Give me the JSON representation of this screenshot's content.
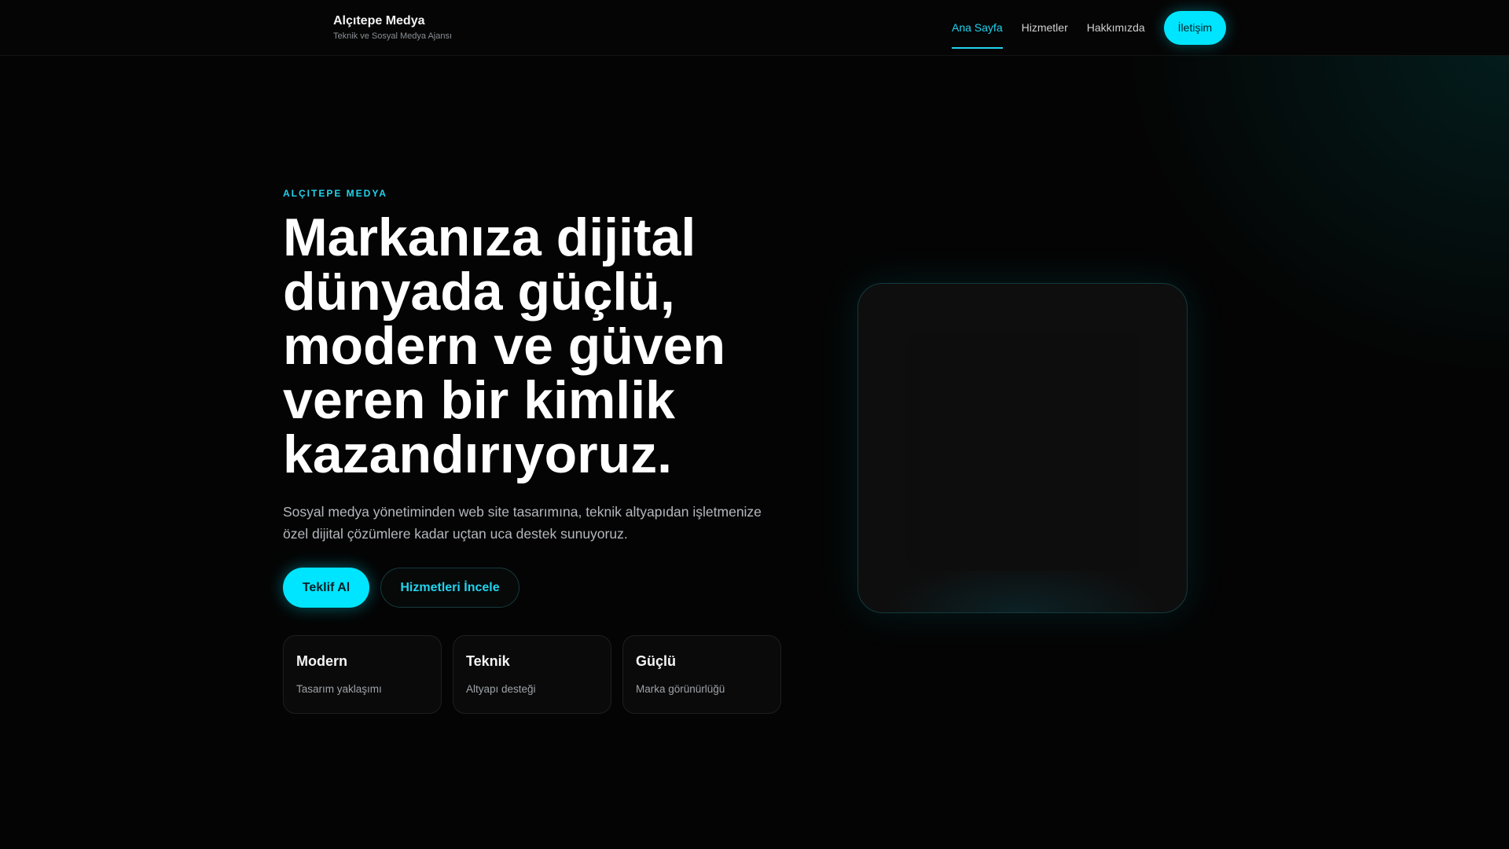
{
  "header": {
    "brand": "Alçıtepe Medya",
    "tagline": "Teknik ve Sosyal Medya Ajansı",
    "nav": [
      {
        "label": "Ana Sayfa",
        "active": true
      },
      {
        "label": "Hizmetler"
      },
      {
        "label": "Hakkımızda"
      }
    ],
    "cta": "İletişim"
  },
  "hero": {
    "eyebrow": "ALÇITEPE MEDYA",
    "title": "Markanıza dijital dünyada güçlü, modern ve güven veren bir kimlik kazandırıyoruz.",
    "lead": "Sosyal medya yönetiminden web site tasarımına, teknik altyapıdan işletmenize özel dijital çözümlere kadar uçtan uca destek sunuyoruz.",
    "primary_button": "Teklif Al",
    "secondary_button": "Hizmetleri İncele",
    "features": [
      {
        "title": "Modern",
        "desc": "Tasarım yaklaşımı"
      },
      {
        "title": "Teknik",
        "desc": "Altyapı desteği"
      },
      {
        "title": "Güçlü",
        "desc": "Marka görünürlüğü"
      }
    ]
  },
  "colors": {
    "accent": "#00e5ff",
    "background": "#040404"
  }
}
